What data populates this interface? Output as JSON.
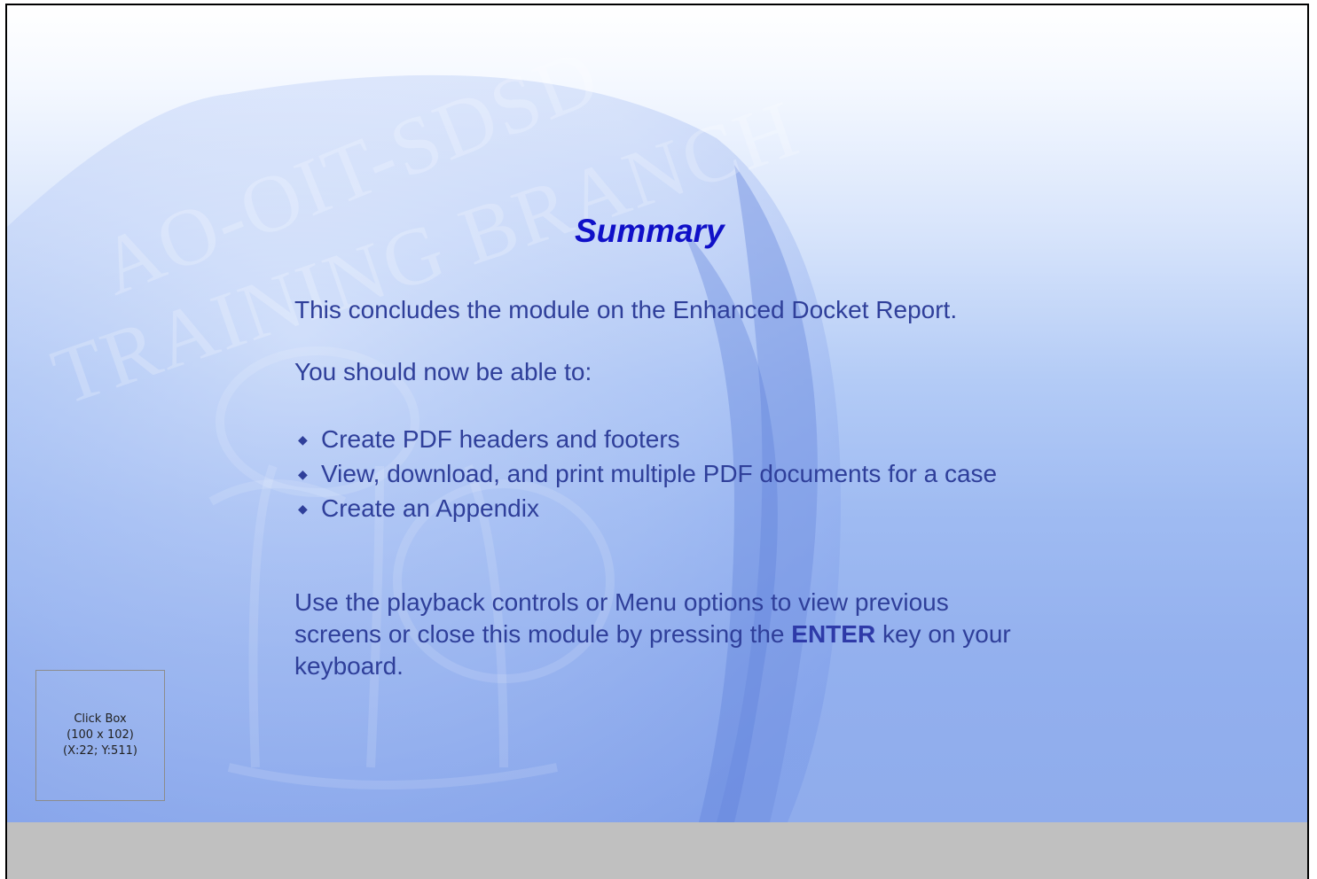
{
  "slide": {
    "title": "Summary",
    "watermark_line1": "AO-OIT-SDSD",
    "watermark_line2": "TRAINING BRANCH",
    "paragraph1": "This concludes the module on the Enhanced Docket Report.",
    "paragraph2": "You should now be able to:",
    "bullets": [
      "Create PDF headers and footers",
      "View, download, and print multiple PDF documents for a case",
      "Create an Appendix"
    ],
    "closing_before": "Use the playback controls or Menu options to view previous screens or close this module by pressing the ",
    "closing_bold": "ENTER",
    "closing_after": " key on your keyboard."
  },
  "click_box": {
    "label": "Click Box",
    "size": "(100 x 102)",
    "position": "(X:22; Y:511)"
  },
  "colors": {
    "title": "#1010c8",
    "body_text": "#2f3f9a",
    "bottom_bar": "#c0c0c0"
  }
}
